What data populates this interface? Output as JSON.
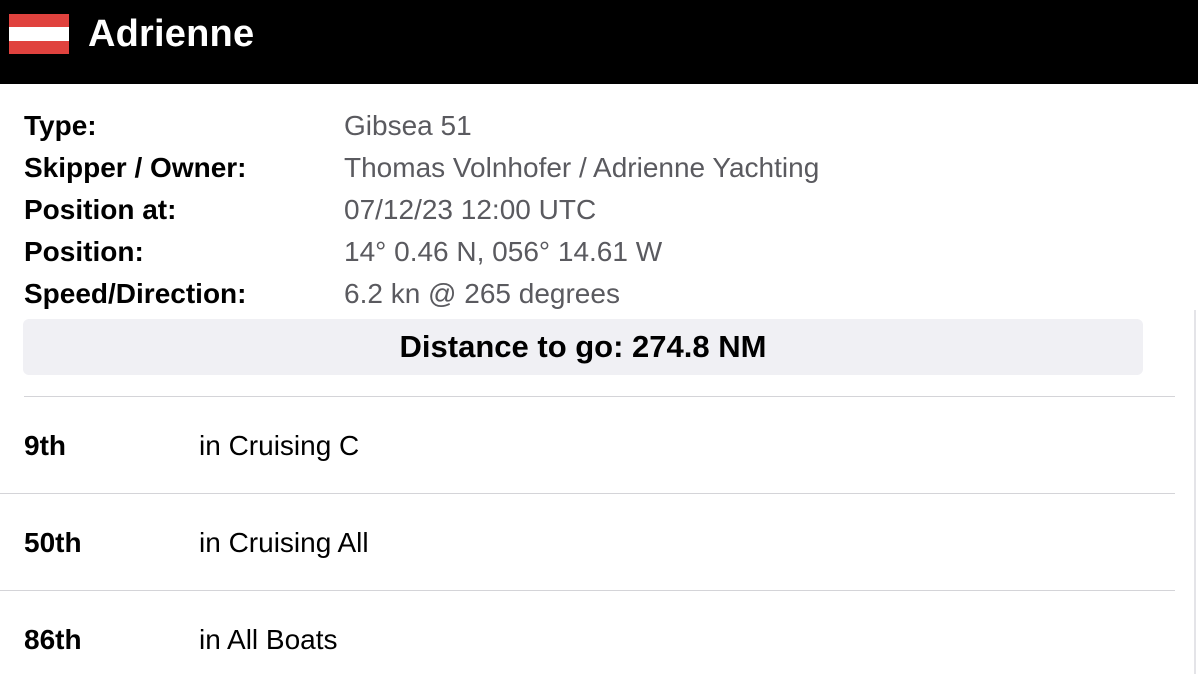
{
  "header": {
    "boat_name": "Adrienne",
    "flag_icon": "austria-flag-icon",
    "flag_colors": {
      "red": "#e0423e",
      "white": "#ffffff"
    }
  },
  "details": {
    "type": {
      "label": "Type:",
      "value": "Gibsea 51"
    },
    "skipper": {
      "label": "Skipper / Owner:",
      "value": "Thomas Volnhofer / Adrienne Yachting"
    },
    "position_at": {
      "label": "Position at:",
      "value": "07/12/23 12:00 UTC"
    },
    "position": {
      "label": "Position:",
      "value": "14° 0.46 N, 056° 14.61 W"
    },
    "speed_direction": {
      "label": "Speed/Direction:",
      "value": "6.2 kn @ 265 degrees"
    }
  },
  "distance": {
    "text": "Distance to go: 274.8 NM"
  },
  "rankings": [
    {
      "position": "9th",
      "category": "in Cruising C"
    },
    {
      "position": "50th",
      "category": "in Cruising All"
    },
    {
      "position": "86th",
      "category": "in All Boats"
    }
  ]
}
